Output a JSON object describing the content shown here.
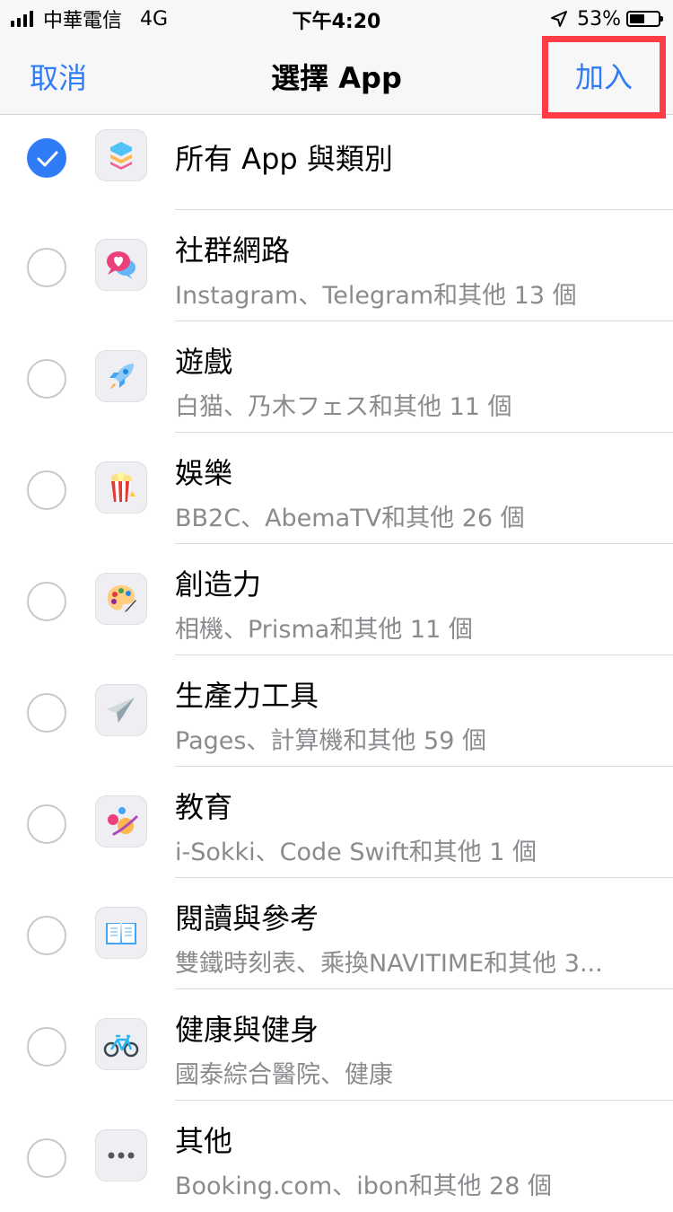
{
  "status_bar": {
    "carrier": "中華電信",
    "network": "4G",
    "time": "下午4:20",
    "battery": "53%",
    "battery_level": 0.53
  },
  "nav": {
    "cancel_label": "取消",
    "title": "選擇 App",
    "add_label": "加入"
  },
  "colors": {
    "accent": "#2f7cf6",
    "highlight_border": "#ff3b46"
  },
  "rows": [
    {
      "title": "所有 App 與類別",
      "subtitle": "",
      "checked": true,
      "icon": "stack-icon"
    },
    {
      "title": "社群網路",
      "subtitle": "Instagram、Telegram和其他 13 個",
      "checked": false,
      "icon": "chat-heart-icon"
    },
    {
      "title": "遊戲",
      "subtitle": "白猫、乃木フェス和其他 11 個",
      "checked": false,
      "icon": "rocket-icon"
    },
    {
      "title": "娛樂",
      "subtitle": "BB2C、AbemaTV和其他 26 個",
      "checked": false,
      "icon": "popcorn-icon"
    },
    {
      "title": "創造力",
      "subtitle": "相機、Prisma和其他 11 個",
      "checked": false,
      "icon": "palette-icon"
    },
    {
      "title": "生產力工具",
      "subtitle": "Pages、計算機和其他 59 個",
      "checked": false,
      "icon": "paper-plane-icon"
    },
    {
      "title": "教育",
      "subtitle": "i-Sokki、Code Swift和其他 1 個",
      "checked": false,
      "icon": "planet-icon"
    },
    {
      "title": "閱讀與參考",
      "subtitle": "雙鐵時刻表、乘換NAVITIME和其他 3...",
      "checked": false,
      "icon": "book-icon"
    },
    {
      "title": "健康與健身",
      "subtitle": "國泰綜合醫院、健康",
      "checked": false,
      "icon": "bicycle-icon"
    },
    {
      "title": "其他",
      "subtitle": "Booking.com、ibon和其他 28 個",
      "checked": false,
      "icon": "more-dots-icon"
    }
  ]
}
